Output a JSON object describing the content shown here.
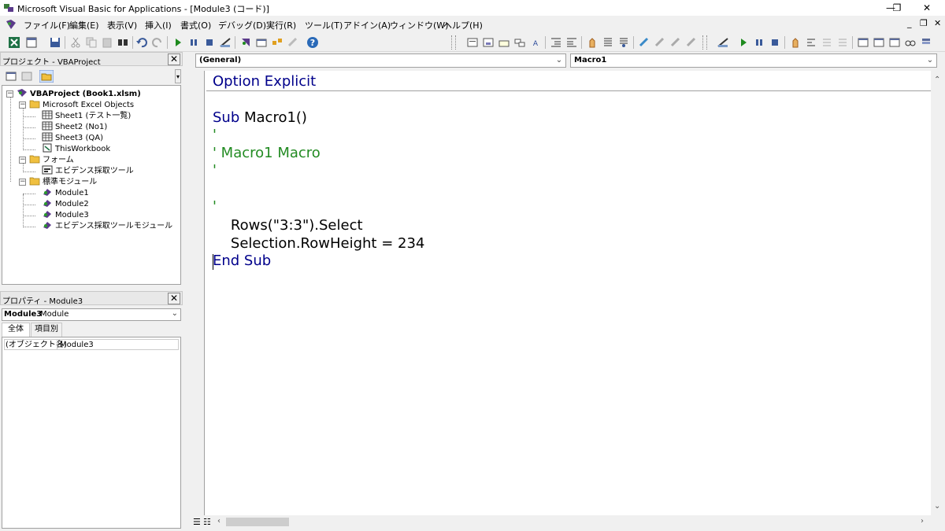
{
  "window": {
    "title": "Microsoft Visual Basic for Applications - [Module3 (コード)]",
    "minimize": "—",
    "restore": "❐",
    "close": "✕"
  },
  "menu": {
    "items": [
      "ファイル(F)",
      "編集(E)",
      "表示(V)",
      "挿入(I)",
      "書式(O)",
      "デバッグ(D)",
      "実行(R)",
      "ツール(T)",
      "アドイン(A)",
      "ウィンドウ(W)",
      "ヘルプ(H)"
    ],
    "mdi_minimize": "_",
    "mdi_restore": "❐",
    "mdi_close": "✕"
  },
  "project_panel": {
    "title": "プロジェクト - VBAProject",
    "close": "✕",
    "tree": {
      "root": "VBAProject (Book1.xlsm)",
      "excel_objects_folder": "Microsoft Excel Objects",
      "sheets": [
        "Sheet1 (テスト一覧)",
        "Sheet2 (No1)",
        "Sheet3 (QA)",
        "ThisWorkbook"
      ],
      "forms_folder": "フォーム",
      "forms": [
        "エビデンス採取ツール"
      ],
      "modules_folder": "標準モジュール",
      "modules": [
        "Module1",
        "Module2",
        "Module3",
        "エビデンス採取ツールモジュール"
      ]
    }
  },
  "properties_panel": {
    "title": "プロパティ - Module3",
    "close": "✕",
    "object_name": "Module3",
    "object_type": "Module",
    "tabs": [
      "全体",
      "項目別"
    ],
    "rows": [
      {
        "name": "(オブジェクト名)",
        "value": "Module3"
      }
    ]
  },
  "code_window": {
    "object_combo": "(General)",
    "procedure_combo": "Macro1",
    "lines": {
      "option": "Option Explicit",
      "sub_decl": "Sub Macro1()",
      "c1": "'",
      "c2": "' Macro1 Macro",
      "c3": "'",
      "c4": "'",
      "s1": "    Rows(\"3:3\").Select",
      "s2": "    Selection.RowHeight = 234",
      "end_sub": "End Sub"
    }
  },
  "colors": {
    "keyword": "#00008b",
    "comment": "#228b22"
  }
}
